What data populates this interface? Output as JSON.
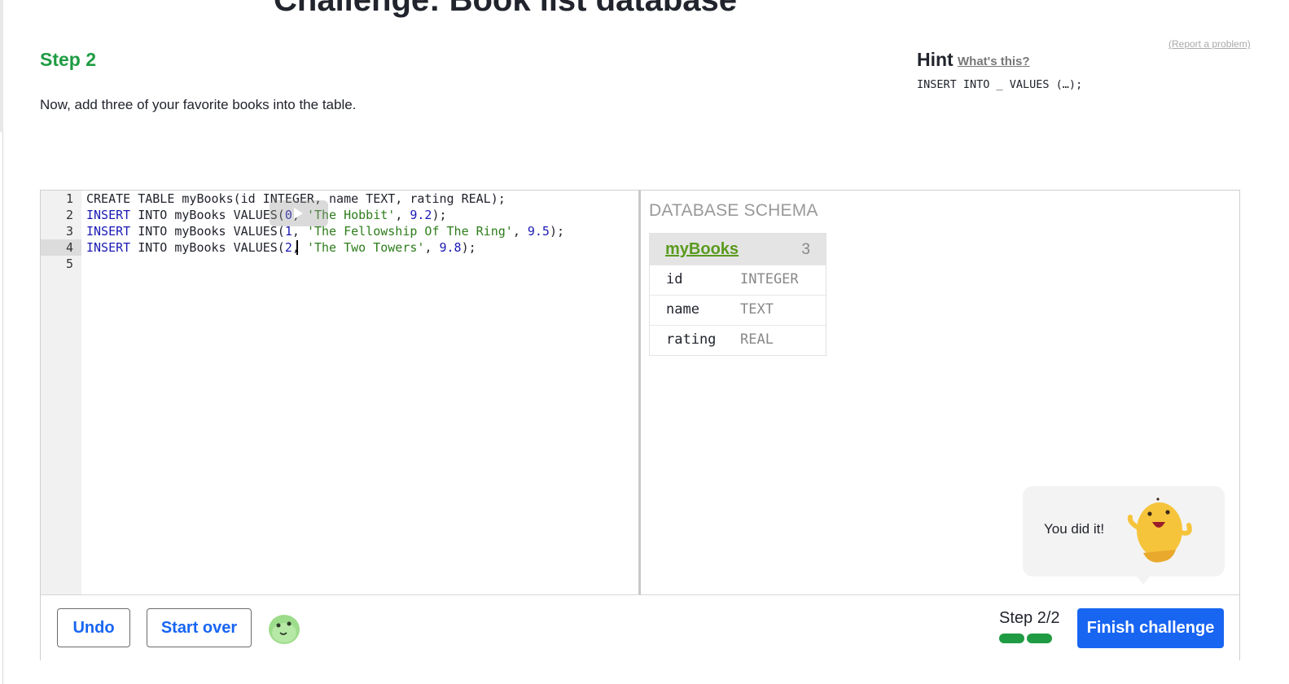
{
  "page": {
    "title": "Challenge: Book list database",
    "report_link": "(Report a problem)"
  },
  "step": {
    "heading": "Step 2",
    "description": "Now, add three of your favorite books into the table."
  },
  "hint": {
    "title": "Hint",
    "link": "What's this?",
    "code": "INSERT INTO _ VALUES (…);"
  },
  "editor": {
    "line_numbers": [
      "1",
      "2",
      "3",
      "4",
      "5"
    ],
    "active_line": 4,
    "lines": [
      {
        "k1": "CREATE TABLE myBooks(id INTEGER, name TEXT, rating REAL);"
      },
      {
        "k1": "INSERT",
        "t1": " INTO myBooks VALUES(",
        "n1": "0",
        "p1": ", ",
        "s1": "'The Hobbit'",
        "p2": ", ",
        "n2": "9.2",
        "p3": ");"
      },
      {
        "k1": "INSERT",
        "t1": " INTO myBooks VALUES(",
        "n1": "1",
        "p1": ", ",
        "s1": "'The Fellowship Of The Ring'",
        "p2": ", ",
        "n2": "9.5",
        "p3": ");"
      },
      {
        "k1": "INSERT",
        "t1": " INTO myBooks VALUES(",
        "n1": "2",
        "p1": ", ",
        "s1": "'The Two Towers'",
        "p2": ", ",
        "n2": "9.8",
        "p3": ");"
      }
    ]
  },
  "schema": {
    "title": "DATABASE SCHEMA",
    "table": {
      "name": "myBooks",
      "row_count": "3",
      "columns": [
        {
          "name": "id",
          "type": "INTEGER"
        },
        {
          "name": "name",
          "type": "TEXT"
        },
        {
          "name": "rating",
          "type": "REAL"
        }
      ]
    }
  },
  "feedback": {
    "message": "You did it!"
  },
  "bottom": {
    "undo_label": "Undo",
    "start_over_label": "Start over",
    "step_counter": "Step 2/2",
    "progress_segments_complete": 2,
    "progress_segments_total": 2,
    "finish_label": "Finish challenge"
  },
  "colors": {
    "step_green": "#1f9c43",
    "primary_blue": "#1865f2",
    "schema_link_green": "#5a9a1e",
    "mascot_yellow": "#f6c43b",
    "mini_mascot_green": "#9ddc8b"
  }
}
